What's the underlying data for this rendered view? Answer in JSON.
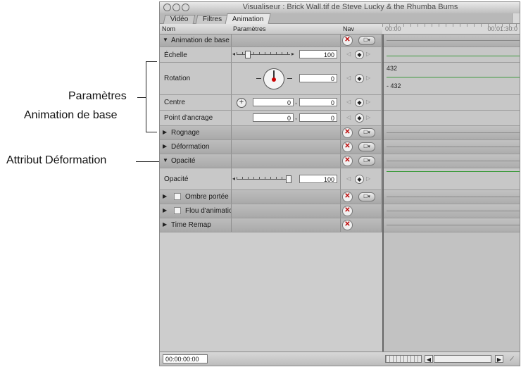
{
  "callouts": {
    "params_line1": "Paramètres",
    "params_line2": "Animation de base",
    "attribute": "Attribut Déformation"
  },
  "window": {
    "title": "Visualiseur : Brick Wall.tif de Steve Lucky & the Rhumba Bums",
    "tabs": [
      "Vidéo",
      "Filtres",
      "Animation"
    ],
    "active_tab": "Animation"
  },
  "header": {
    "col_name": "Nom",
    "col_params": "Paramètres",
    "col_nav": "Nav"
  },
  "timeline": {
    "start": "00:00",
    "end": "00:01:30:0"
  },
  "rows": {
    "basic_motion": "Animation de base",
    "scale": {
      "label": "Échelle",
      "value": "100",
      "level": 0.08
    },
    "rotation": {
      "label": "Rotation",
      "value": "0",
      "tl_high": "432",
      "tl_low": "- 432"
    },
    "center": {
      "label": "Centre",
      "x": "0",
      "y": "0",
      "sep": ","
    },
    "anchor": {
      "label": "Point d'ancrage",
      "x": "0",
      "y": "0",
      "sep": ","
    },
    "crop": "Rognage",
    "distort": "Déformation",
    "opacity_group": "Opacité",
    "opacity": {
      "label": "Opacité",
      "value": "100",
      "level": 1.0
    },
    "drop_shadow": "Ombre portée",
    "motion_blur": "Flou d'animatio",
    "time_remap": "Time Remap"
  },
  "icons": {
    "reset": "x-icon",
    "menu": "menu-icon",
    "keyframe": "diamond-icon",
    "add": "plus-icon"
  },
  "colors": {
    "reset_x": "#bb0000",
    "curve": "#3d9a3d",
    "dial_hub": "#cc0000"
  },
  "bottom": {
    "timecode": "00:00:00:00"
  }
}
